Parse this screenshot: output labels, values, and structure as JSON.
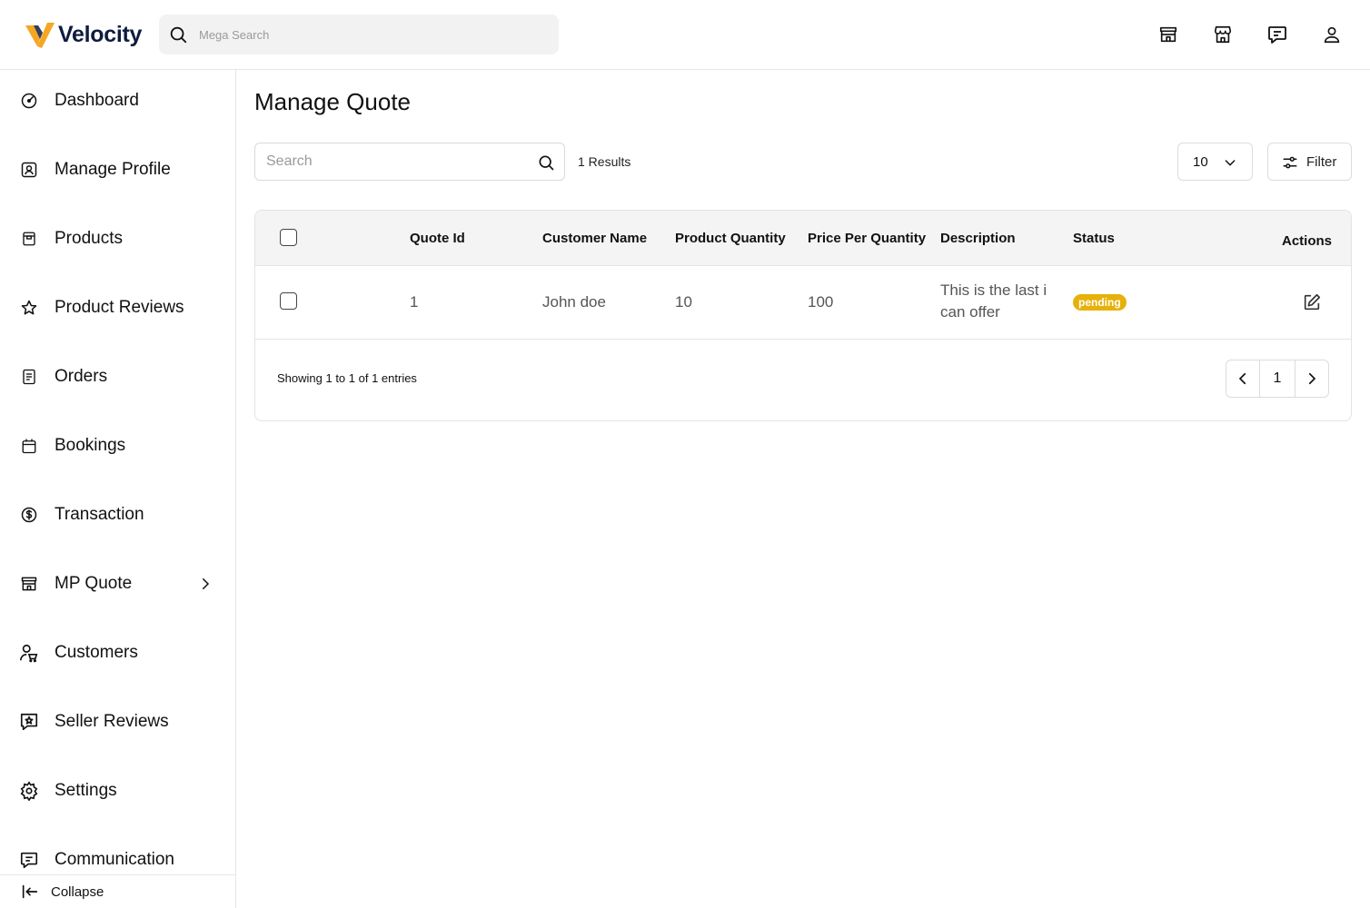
{
  "brand": {
    "name": "Velocity",
    "colors": {
      "accent": "#F5A623",
      "navy": "#0F1C3F",
      "badge_pending": "#E7B10B"
    }
  },
  "header": {
    "mega_search_placeholder": "Mega Search",
    "icons": [
      "store-icon",
      "shop-front-icon",
      "chat-icon",
      "user-icon"
    ]
  },
  "sidebar": {
    "items": [
      {
        "label": "Dashboard",
        "icon": "dashboard-icon"
      },
      {
        "label": "Manage Profile",
        "icon": "profile-icon"
      },
      {
        "label": "Products",
        "icon": "products-icon"
      },
      {
        "label": "Product Reviews",
        "icon": "star-icon"
      },
      {
        "label": "Orders",
        "icon": "orders-icon"
      },
      {
        "label": "Bookings",
        "icon": "calendar-icon"
      },
      {
        "label": "Transaction",
        "icon": "dollar-icon"
      },
      {
        "label": "MP Quote",
        "icon": "store-icon",
        "has_submenu": true
      },
      {
        "label": "Customers",
        "icon": "customers-icon"
      },
      {
        "label": "Seller Reviews",
        "icon": "seller-review-icon"
      },
      {
        "label": "Settings",
        "icon": "gear-icon"
      },
      {
        "label": "Communication",
        "icon": "chat-icon"
      }
    ],
    "collapse_label": "Collapse"
  },
  "main": {
    "title": "Manage Quote",
    "search_placeholder": "Search",
    "results_text": "1 Results",
    "page_size": "10",
    "filter_label": "Filter",
    "table": {
      "columns": [
        "Quote Id",
        "Customer Name",
        "Product Quantity",
        "Price Per Quantity",
        "Description",
        "Status",
        "Actions"
      ],
      "rows": [
        {
          "quote_id": "1",
          "customer_name": "John doe",
          "product_quantity": "10",
          "price_per_quantity": "100",
          "description": "This is the last i can offer",
          "status": "pending"
        }
      ]
    },
    "showing_text": "Showing 1 to 1 of 1 entries",
    "current_page": "1"
  }
}
